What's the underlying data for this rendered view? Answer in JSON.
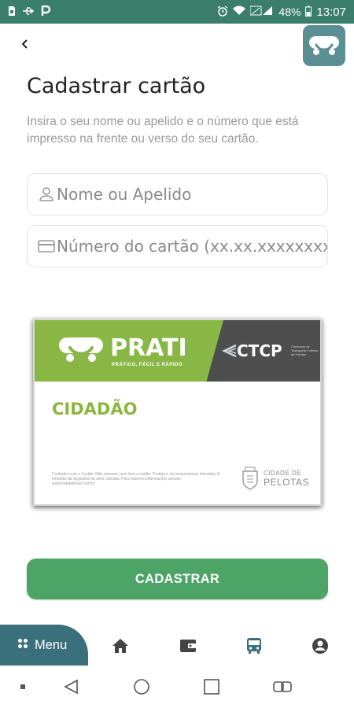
{
  "status_bar": {
    "battery": "48%",
    "time": "13:07",
    "left_icons": [
      "sim-icon",
      "usb-icon",
      "parking-icon"
    ],
    "right_icons": [
      "alarm-icon",
      "wifi-icon",
      "signal-icon",
      "battery-icon"
    ]
  },
  "header": {
    "back_icon": "back-arrow-icon",
    "logo_icon": "prati-bus-logo-icon"
  },
  "page": {
    "title": "Cadastrar cartão",
    "subtitle": "Insira o seu nome ou apelido e o número que está impresso na frente ou verso do seu cartão."
  },
  "form": {
    "name_placeholder": "Nome ou Apelido",
    "name_value": "",
    "card_placeholder": "Número do cartão (xx.xx.xxxxxxxx-x)",
    "card_value": ""
  },
  "card": {
    "brand": "PRATI",
    "tagline": "PRÁTICO, FÁCIL E RÁPIDO",
    "operator": "CTCP",
    "operator_sub": "Consórcio de Transporte Coletivo de Pelotas",
    "category": "CIDADÃO",
    "note": "Cuidados com o Cartão: Não amasse, nem fure o cartão. Proteja-o de temperaturas elevadas. A emissão da Segunda via será cobrada. Para maiores informações acesse: www.pratipelotas.com.br",
    "city_line1": "CIDADE DE",
    "city_line2": "PELOTAS",
    "colors": {
      "green": "#89b746",
      "dark": "#4e4e4e"
    }
  },
  "actions": {
    "submit_label": "CADASTRAR"
  },
  "bottom_nav": {
    "menu_label": "Menu",
    "items": [
      "home-icon",
      "wallet-icon",
      "bus-icon",
      "profile-icon"
    ],
    "active": "bus-icon"
  },
  "colors": {
    "status_bar": "#3b7e6c",
    "primary_button": "#4ca566",
    "menu_tab": "#3a6f7c",
    "logo_bg": "#5b8f93"
  }
}
